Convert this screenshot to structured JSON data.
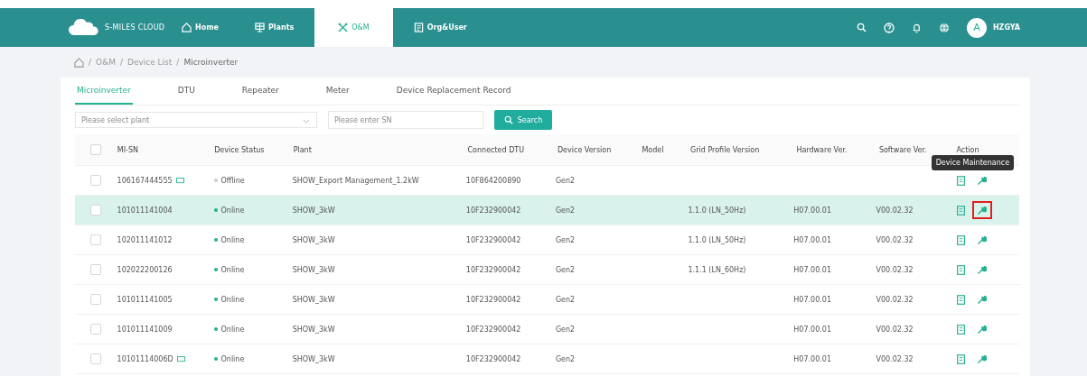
{
  "brand": "S-MILES CLOUD",
  "nav": [
    {
      "label": "Home",
      "selected": false
    },
    {
      "label": "Plants",
      "selected": false
    },
    {
      "label": "O&M",
      "selected": true
    },
    {
      "label": "Org&User",
      "selected": false
    }
  ],
  "user": {
    "avatar": "A",
    "name": "HZGYA"
  },
  "breadcrumb": [
    {
      "separator": "/",
      "label": "O&M"
    },
    {
      "separator": "/",
      "label": "Device List"
    },
    {
      "separator": "/",
      "label": "Microinverter"
    }
  ],
  "tabs": [
    {
      "label": "Microinverter",
      "selected": true
    },
    {
      "label": "DTU",
      "selected": false
    },
    {
      "label": "Repeater",
      "selected": false
    },
    {
      "label": "Meter",
      "selected": false
    },
    {
      "label": "Device Replacement Record",
      "selected": false
    }
  ],
  "filters": {
    "plant": {
      "placeholder": "Please select plant"
    },
    "sn": {
      "placeholder": "Please enter SN"
    },
    "search_button": "Search"
  },
  "table": {
    "select_all_checked": false,
    "columns": [
      "MI-SN",
      "Device Status",
      "Plant",
      "Connected DTU",
      "Device Version",
      "Model",
      "Grid Profile Version",
      "Hardware Ver.",
      "Software Ver.",
      "Action"
    ],
    "rows": [
      {
        "checked": false,
        "selected": false,
        "sn": "106167444555",
        "sn_tag": true,
        "status": "Offline",
        "color": "#cccccc",
        "plant": "SHOW_Export Management_1.2kW",
        "dtu": "10F864200890",
        "version": "Gen2",
        "model": "",
        "grid": "",
        "hw": "",
        "sw": "",
        "maintenance_marked": false,
        "tooltip": "Device Maintenance"
      },
      {
        "checked": false,
        "selected": true,
        "sn": "101011141004",
        "sn_tag": false,
        "status": "Online",
        "color": "#26b08f",
        "plant": "SHOW_3kW",
        "dtu": "10F232900042",
        "version": "Gen2",
        "model": "",
        "grid": "1.1.0 (LN_50Hz)",
        "hw": "H07.00.01",
        "sw": "V00.02.32",
        "maintenance_marked": true
      },
      {
        "checked": false,
        "selected": false,
        "sn": "102011141012",
        "sn_tag": false,
        "status": "Online",
        "color": "#26b08f",
        "plant": "SHOW_3kW",
        "dtu": "10F232900042",
        "version": "Gen2",
        "model": "",
        "grid": "1.1.0 (LN_50Hz)",
        "hw": "H07.00.01",
        "sw": "V00.02.32",
        "maintenance_marked": false
      },
      {
        "checked": false,
        "selected": false,
        "sn": "102022200126",
        "sn_tag": false,
        "status": "Online",
        "color": "#26b08f",
        "plant": "SHOW_3kW",
        "dtu": "10F232900042",
        "version": "Gen2",
        "model": "",
        "grid": "1.1.1 (LN_60Hz)",
        "hw": "H07.00.01",
        "sw": "V00.02.32",
        "maintenance_marked": false
      },
      {
        "checked": false,
        "selected": false,
        "sn": "101011141005",
        "sn_tag": false,
        "status": "Online",
        "color": "#26b08f",
        "plant": "SHOW_3kW",
        "dtu": "10F232900042",
        "version": "Gen2",
        "model": "",
        "grid": "",
        "hw": "H07.00.01",
        "sw": "V00.02.32",
        "maintenance_marked": false
      },
      {
        "checked": false,
        "selected": false,
        "sn": "101011141009",
        "sn_tag": false,
        "status": "Online",
        "color": "#26b08f",
        "plant": "SHOW_3kW",
        "dtu": "10F232900042",
        "version": "Gen2",
        "model": "",
        "grid": "",
        "hw": "H07.00.01",
        "sw": "V00.02.32",
        "maintenance_marked": false
      },
      {
        "checked": false,
        "selected": false,
        "sn": "10101114006D",
        "sn_tag": true,
        "status": "Online",
        "color": "#26b08f",
        "plant": "SHOW_3kW",
        "dtu": "10F232900042",
        "version": "Gen2",
        "model": "",
        "grid": "",
        "hw": "H07.00.01",
        "sw": "V00.02.32",
        "maintenance_marked": false
      }
    ]
  }
}
